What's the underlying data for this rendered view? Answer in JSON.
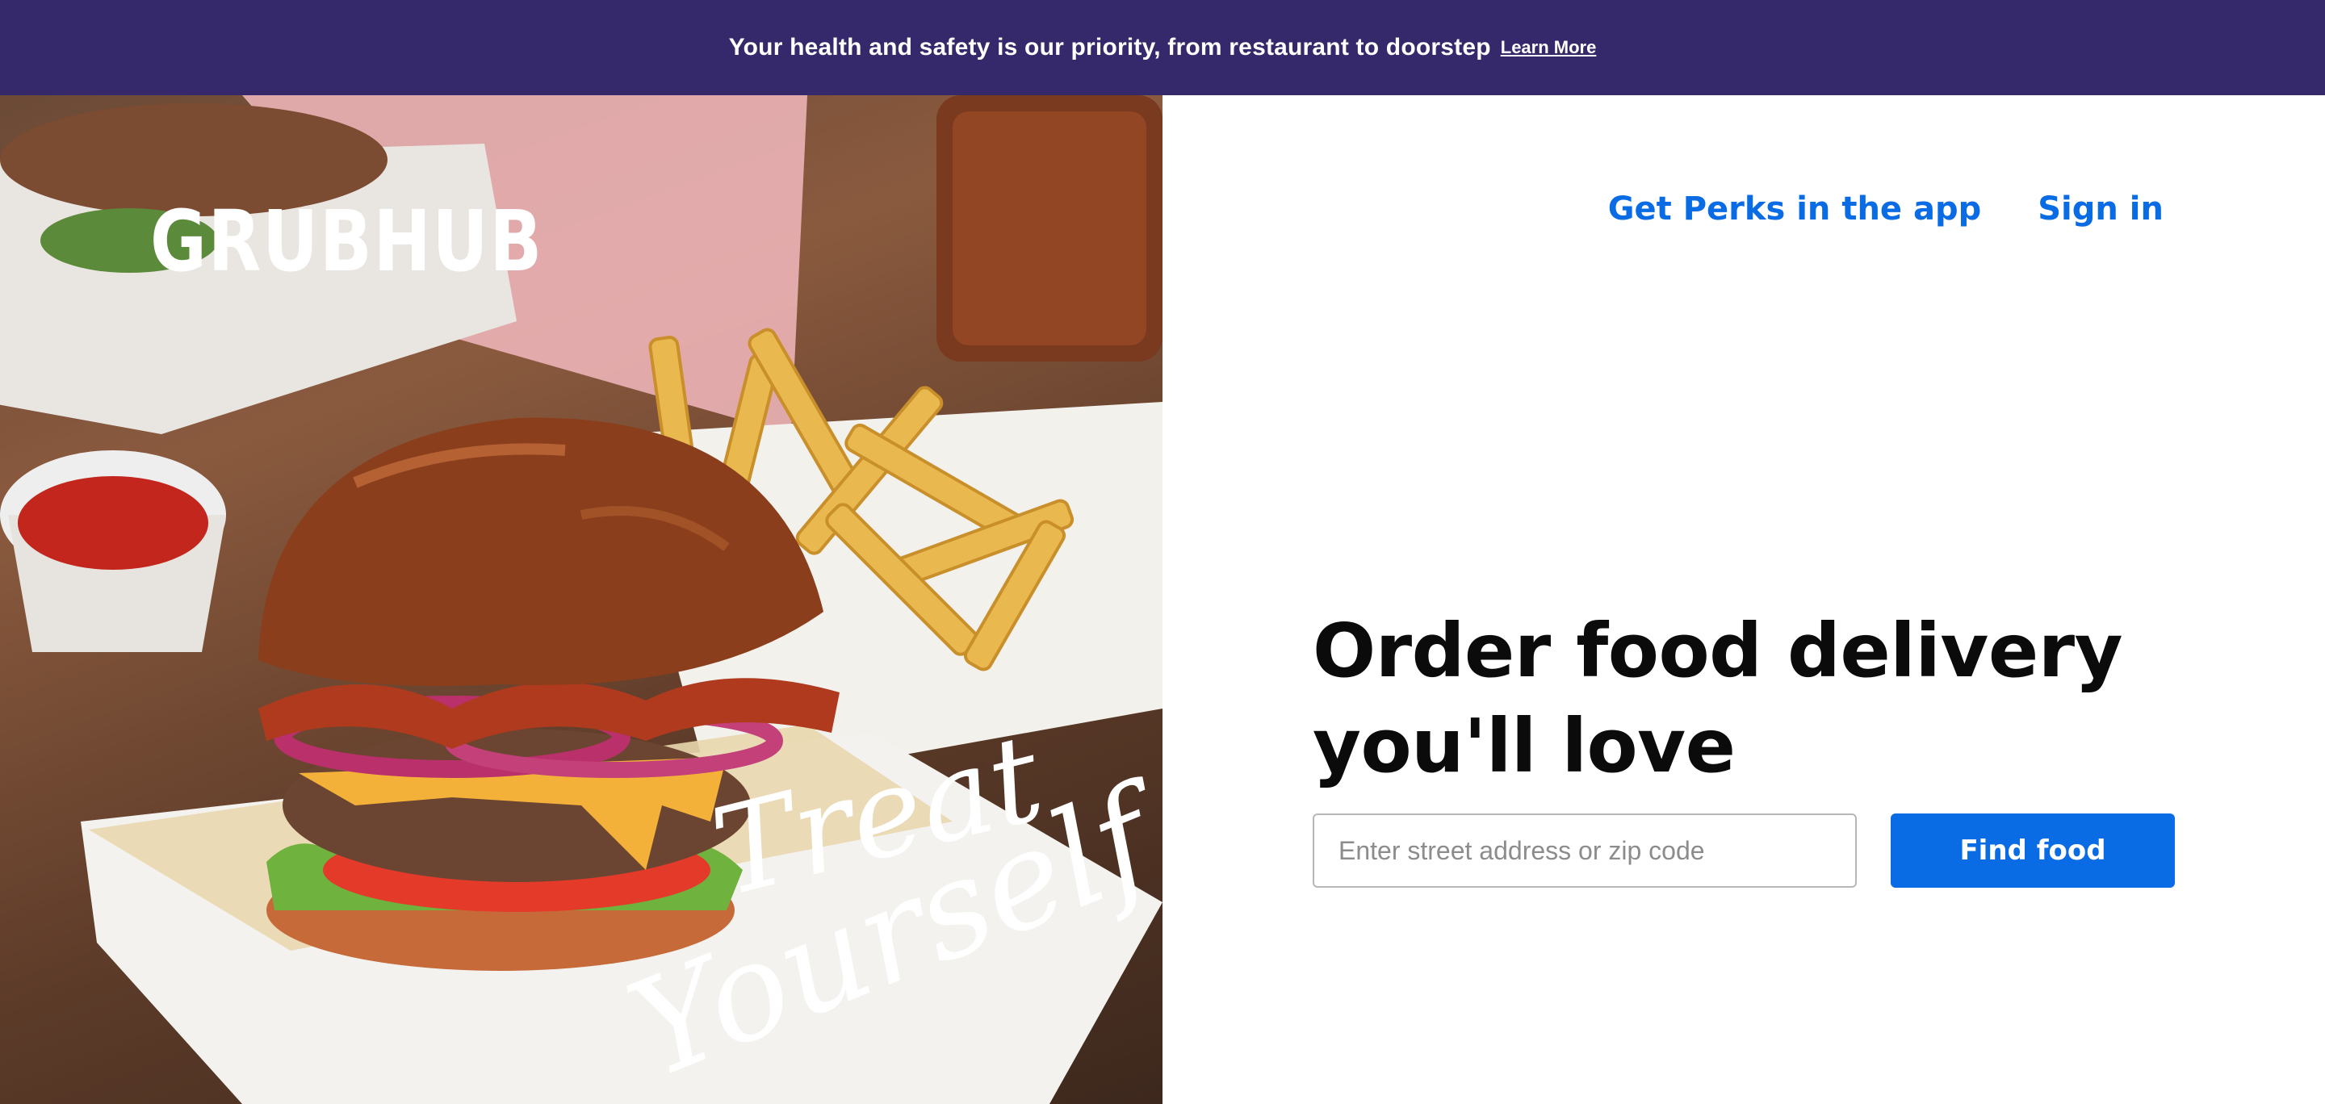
{
  "banner": {
    "message": "Your health and safety is our priority, from restaurant to doorstep",
    "link_label": "Learn More"
  },
  "hero": {
    "logo_text": "GRUBHUB",
    "script_line_1": "Treat",
    "script_line_2": "Yourself"
  },
  "nav": {
    "perks_label": "Get Perks in the app",
    "signin_label": "Sign in"
  },
  "main": {
    "headline_line_1": "Order food delivery",
    "headline_line_2": "you'll love",
    "search_placeholder": "Enter street address or zip code",
    "search_value": "",
    "find_button_label": "Find food"
  },
  "colors": {
    "banner_bg": "#35286b",
    "brand_blue": "#0a6ce4",
    "headline": "#0b0b0b"
  }
}
